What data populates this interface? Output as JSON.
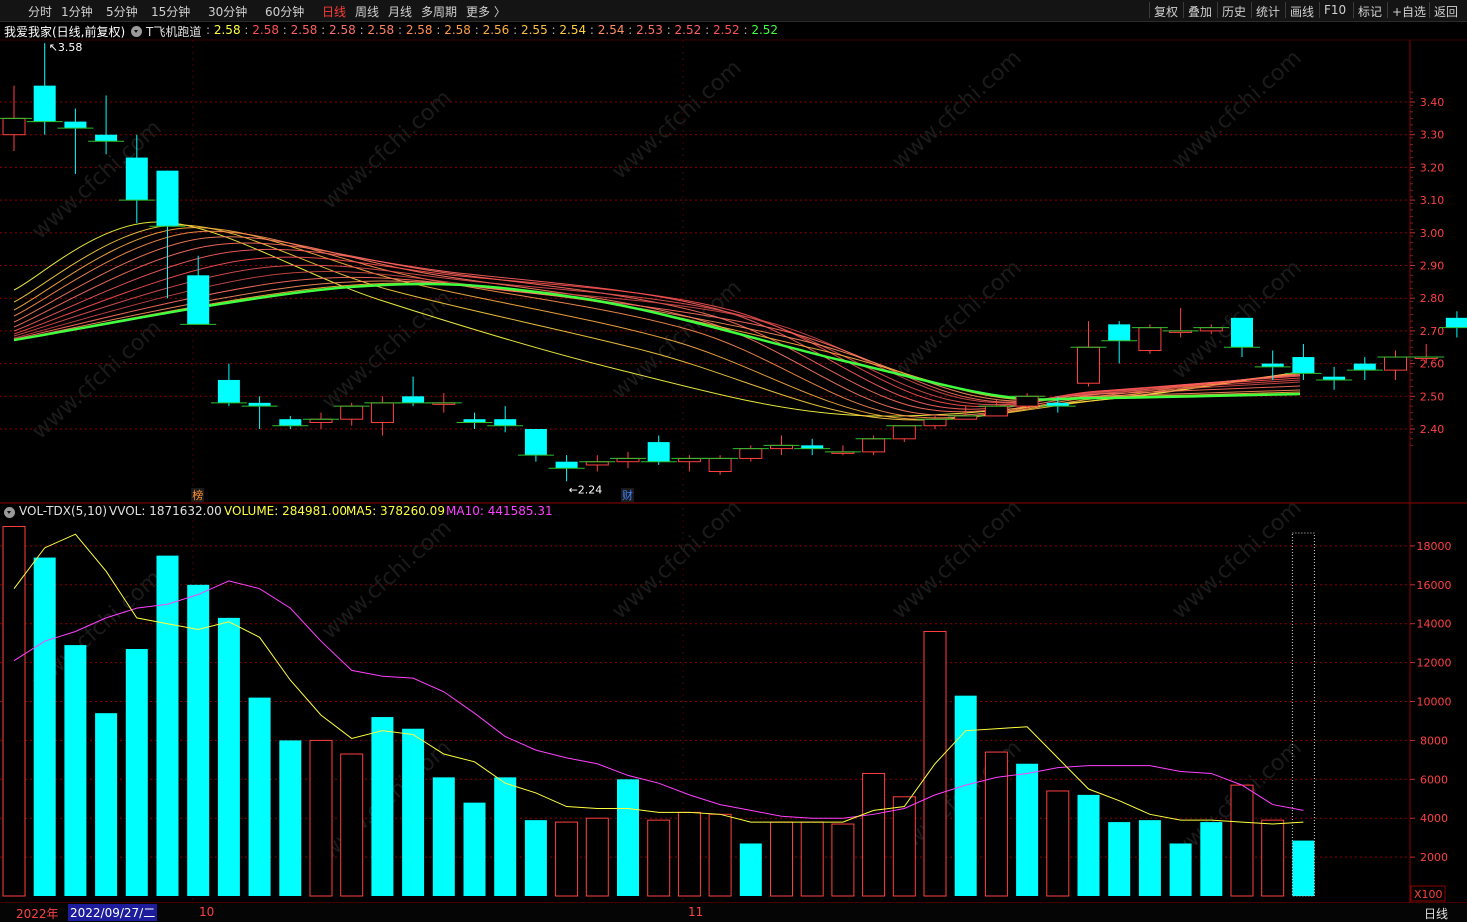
{
  "toolbar": {
    "periods": [
      "分时",
      "1分钟",
      "5分钟",
      "15分钟",
      "30分钟",
      "60分钟",
      "日线",
      "周线",
      "月线",
      "多周期",
      "更多 〉"
    ],
    "active_period": "日线",
    "tools": [
      "复权",
      "叠加",
      "历史",
      "统计",
      "画线",
      "F10",
      "标记",
      "+自选",
      "返回"
    ]
  },
  "price_panel": {
    "stock_label": "我爱我家(日线,前复权)",
    "indicator_name": "T飞机跑道",
    "indicator_values": [
      {
        "text": "2.58",
        "color": "#ffff40"
      },
      {
        "text": "2.58",
        "color": "#ff5050"
      },
      {
        "text": "2.58",
        "color": "#ff6060"
      },
      {
        "text": "2.58",
        "color": "#ff7070"
      },
      {
        "text": "2.58",
        "color": "#ff8060"
      },
      {
        "text": "2.58",
        "color": "#ff9050"
      },
      {
        "text": "2.58",
        "color": "#ffa040"
      },
      {
        "text": "2.56",
        "color": "#ffb040"
      },
      {
        "text": "2.55",
        "color": "#ffc040"
      },
      {
        "text": "2.54",
        "color": "#ffd040"
      },
      {
        "text": "2.54",
        "color": "#ff9060"
      },
      {
        "text": "2.53",
        "color": "#ff7060"
      },
      {
        "text": "2.52",
        "color": "#ff6060"
      },
      {
        "text": "2.52",
        "color": "#ff5050"
      },
      {
        "text": "2.52",
        "color": "#40ff40"
      }
    ],
    "high_annotation": "3.58",
    "low_annotation": "←2.24",
    "event_markers": [
      "榜",
      "财"
    ]
  },
  "volume_panel": {
    "title": "VOL-TDX(5,10)",
    "vvol": "VVOL: 1871632.00",
    "volume": "VOLUME: 284981.00",
    "ma5": "MA5: 378260.09",
    "ma10": "MA10: 441585.31",
    "unit": "X100"
  },
  "bottom": {
    "year_label": "2022年",
    "cursor_date": "2022/09/27/二",
    "month_labels": [
      "10",
      "11"
    ],
    "period_label": "日线"
  },
  "watermark": "www.cfchi.com",
  "colors": {
    "up": "#ff4040",
    "down": "#00ffff",
    "ma5": "#ffff40",
    "ma10": "#ff40ff",
    "green_line": "#40ff40",
    "grid": "#8b0000"
  },
  "chart_data": {
    "type": "candlestick",
    "price_axis": {
      "ticks": [
        "3.40",
        "3.30",
        "3.20",
        "3.10",
        "3.00",
        "2.90",
        "2.80",
        "2.70",
        "2.60",
        "2.50",
        "2.40"
      ],
      "range": [
        2.24,
        3.58
      ]
    },
    "volume_axis": {
      "ticks": [
        "18000",
        "16000",
        "14000",
        "12000",
        "10000",
        "8000",
        "6000",
        "4000",
        "2000"
      ],
      "range": [
        0,
        19000
      ]
    },
    "candles": [
      {
        "o": 3.3,
        "h": 3.45,
        "l": 3.25,
        "c": 3.35
      },
      {
        "o": 3.45,
        "h": 3.58,
        "l": 3.3,
        "c": 3.34
      },
      {
        "o": 3.34,
        "h": 3.38,
        "l": 3.18,
        "c": 3.32
      },
      {
        "o": 3.3,
        "h": 3.42,
        "l": 3.24,
        "c": 3.28
      },
      {
        "o": 3.23,
        "h": 3.3,
        "l": 3.03,
        "c": 3.1
      },
      {
        "o": 3.19,
        "h": 3.19,
        "l": 2.8,
        "c": 3.02
      },
      {
        "o": 2.87,
        "h": 2.93,
        "l": 2.72,
        "c": 2.72
      },
      {
        "o": 2.55,
        "h": 2.6,
        "l": 2.47,
        "c": 2.48
      },
      {
        "o": 2.48,
        "h": 2.5,
        "l": 2.4,
        "c": 2.47
      },
      {
        "o": 2.43,
        "h": 2.44,
        "l": 2.4,
        "c": 2.41
      },
      {
        "o": 2.42,
        "h": 2.45,
        "l": 2.4,
        "c": 2.43
      },
      {
        "o": 2.43,
        "h": 2.48,
        "l": 2.41,
        "c": 2.47
      },
      {
        "o": 2.42,
        "h": 2.5,
        "l": 2.38,
        "c": 2.48
      },
      {
        "o": 2.5,
        "h": 2.56,
        "l": 2.47,
        "c": 2.48
      },
      {
        "o": 2.48,
        "h": 2.51,
        "l": 2.45,
        "c": 2.48
      },
      {
        "o": 2.43,
        "h": 2.45,
        "l": 2.4,
        "c": 2.42
      },
      {
        "o": 2.43,
        "h": 2.47,
        "l": 2.39,
        "c": 2.41
      },
      {
        "o": 2.4,
        "h": 2.4,
        "l": 2.3,
        "c": 2.32
      },
      {
        "o": 2.3,
        "h": 2.32,
        "l": 2.24,
        "c": 2.28
      },
      {
        "o": 2.29,
        "h": 2.32,
        "l": 2.27,
        "c": 2.3
      },
      {
        "o": 2.3,
        "h": 2.33,
        "l": 2.28,
        "c": 2.31
      },
      {
        "o": 2.36,
        "h": 2.38,
        "l": 2.29,
        "c": 2.3
      },
      {
        "o": 2.3,
        "h": 2.32,
        "l": 2.27,
        "c": 2.31
      },
      {
        "o": 2.27,
        "h": 2.32,
        "l": 2.26,
        "c": 2.31
      },
      {
        "o": 2.31,
        "h": 2.35,
        "l": 2.3,
        "c": 2.34
      },
      {
        "o": 2.34,
        "h": 2.38,
        "l": 2.32,
        "c": 2.35
      },
      {
        "o": 2.35,
        "h": 2.37,
        "l": 2.32,
        "c": 2.34
      },
      {
        "o": 2.33,
        "h": 2.35,
        "l": 2.32,
        "c": 2.33
      },
      {
        "o": 2.33,
        "h": 2.38,
        "l": 2.32,
        "c": 2.37
      },
      {
        "o": 2.37,
        "h": 2.41,
        "l": 2.36,
        "c": 2.41
      },
      {
        "o": 2.41,
        "h": 2.44,
        "l": 2.4,
        "c": 2.43
      },
      {
        "o": 2.43,
        "h": 2.47,
        "l": 2.43,
        "c": 2.44
      },
      {
        "o": 2.44,
        "h": 2.49,
        "l": 2.44,
        "c": 2.47
      },
      {
        "o": 2.47,
        "h": 2.51,
        "l": 2.46,
        "c": 2.5
      },
      {
        "o": 2.48,
        "h": 2.5,
        "l": 2.45,
        "c": 2.47
      },
      {
        "o": 2.54,
        "h": 2.73,
        "l": 2.53,
        "c": 2.65
      },
      {
        "o": 2.72,
        "h": 2.73,
        "l": 2.6,
        "c": 2.67
      },
      {
        "o": 2.64,
        "h": 2.72,
        "l": 2.63,
        "c": 2.71
      },
      {
        "o": 2.7,
        "h": 2.77,
        "l": 2.68,
        "c": 2.7
      },
      {
        "o": 2.7,
        "h": 2.72,
        "l": 2.69,
        "c": 2.71
      },
      {
        "o": 2.74,
        "h": 2.74,
        "l": 2.62,
        "c": 2.65
      },
      {
        "o": 2.6,
        "h": 2.64,
        "l": 2.55,
        "c": 2.59
      },
      {
        "o": 2.62,
        "h": 2.66,
        "l": 2.55,
        "c": 2.57
      },
      {
        "o": 2.56,
        "h": 2.59,
        "l": 2.52,
        "c": 2.55
      },
      {
        "o": 2.6,
        "h": 2.62,
        "l": 2.55,
        "c": 2.58
      },
      {
        "o": 2.58,
        "h": 2.64,
        "l": 2.55,
        "c": 2.62
      },
      {
        "o": 2.62,
        "h": 2.66,
        "l": 2.6,
        "c": 2.62
      },
      {
        "o": 2.74,
        "h": 2.76,
        "l": 2.68,
        "c": 2.71
      }
    ],
    "volume": [
      19000,
      17400,
      12900,
      9400,
      12700,
      17500,
      16000,
      14300,
      10200,
      8000,
      8000,
      7300,
      9200,
      8600,
      6100,
      4800,
      6100,
      3900,
      3800,
      4000,
      6000,
      3900,
      4300,
      4200,
      2700,
      3800,
      3800,
      3700,
      6300,
      5100,
      13600,
      10300,
      7400,
      6800,
      5400,
      5200,
      3800,
      3900,
      2700,
      3800,
      5700,
      3900,
      2849
    ],
    "volume_up": [
      true,
      false,
      false,
      false,
      false,
      false,
      false,
      false,
      false,
      false,
      true,
      true,
      false,
      false,
      false,
      false,
      false,
      false,
      true,
      true,
      false,
      true,
      true,
      true,
      false,
      true,
      true,
      true,
      true,
      true,
      true,
      false,
      true,
      false,
      true,
      false,
      false,
      false,
      false,
      false,
      true,
      true,
      false
    ],
    "ma5": [
      15800,
      17900,
      18600,
      16700,
      14300,
      14000,
      13700,
      14100,
      13300,
      11100,
      9300,
      8100,
      8500,
      8300,
      7300,
      6900,
      5800,
      5300,
      4600,
      4500,
      4500,
      4300,
      4300,
      4200,
      3800,
      3800,
      3800,
      3800,
      4400,
      4600,
      6800,
      8500,
      8600,
      8700,
      7100,
      5500,
      4900,
      4200,
      3900,
      3900,
      3800,
      3700,
      3800
    ],
    "ma10": [
      12100,
      13100,
      13600,
      14300,
      14800,
      15000,
      15500,
      16200,
      15800,
      14800,
      13100,
      11600,
      11300,
      11200,
      10500,
      9400,
      8200,
      7500,
      7100,
      6800,
      6200,
      5800,
      5200,
      4700,
      4400,
      4100,
      4000,
      4000,
      4200,
      4500,
      5200,
      5700,
      6100,
      6300,
      6600,
      6700,
      6700,
      6700,
      6400,
      6300,
      5700,
      4700,
      4400
    ]
  }
}
